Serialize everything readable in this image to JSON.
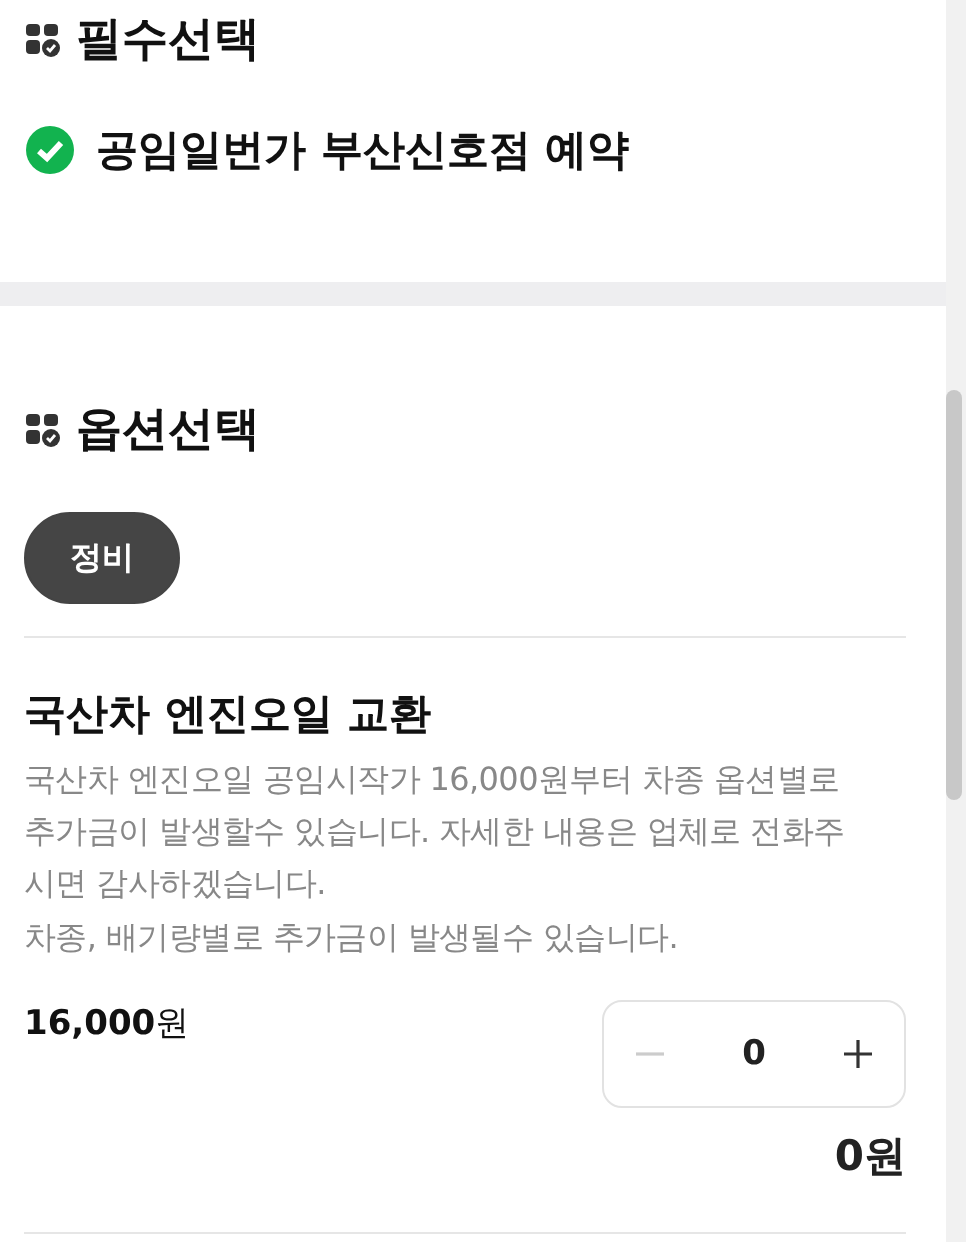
{
  "required_section": {
    "title": "필수선택",
    "items": [
      {
        "label": "공임일번가 부산신호점 예약",
        "checked": true
      }
    ]
  },
  "option_section": {
    "title": "옵션선택",
    "chips": [
      {
        "label": "정비",
        "selected": true
      }
    ],
    "products": [
      {
        "name": "국산차 엔진오일 교환",
        "description": "국산차 엔진오일 공임시작가 16,000원부터 차종 옵션별로 추가금이 발생할수 있습니다. 자세한 내용은 업체로 전화주시면 감사하겠습니다.",
        "note": "차종, 배기량별로 추가금이 발생될수 있습니다.",
        "price": "**16,000**원",
        "quantity": "0",
        "decrement_disabled": true,
        "total": "0원"
      }
    ]
  }
}
